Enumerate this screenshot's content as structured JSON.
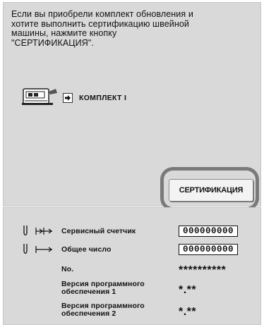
{
  "message": "Если вы приобрели комплект обновления и\nхотите выполнить сертификацию швейной\nмашины, нажмите кнопку\n\"СЕРТИФИКАЦИЯ\".",
  "kit": {
    "label": "КОМПЛЕКТ I",
    "icon": "sewing-machine-icon"
  },
  "certify_button": "СЕРТИФИКАЦИЯ",
  "info": {
    "service_counter": {
      "label": "Сервисный счетчик",
      "value": "000000000"
    },
    "total_count": {
      "label": "Общее число",
      "value": "000000000"
    },
    "number": {
      "label": "No.",
      "value": "**********"
    },
    "software_version_1": {
      "label": "Версия программного\nобеспечения 1",
      "value": "*.**"
    },
    "software_version_2": {
      "label": "Версия программного\nобеспечения 2",
      "value": "*.**"
    }
  }
}
